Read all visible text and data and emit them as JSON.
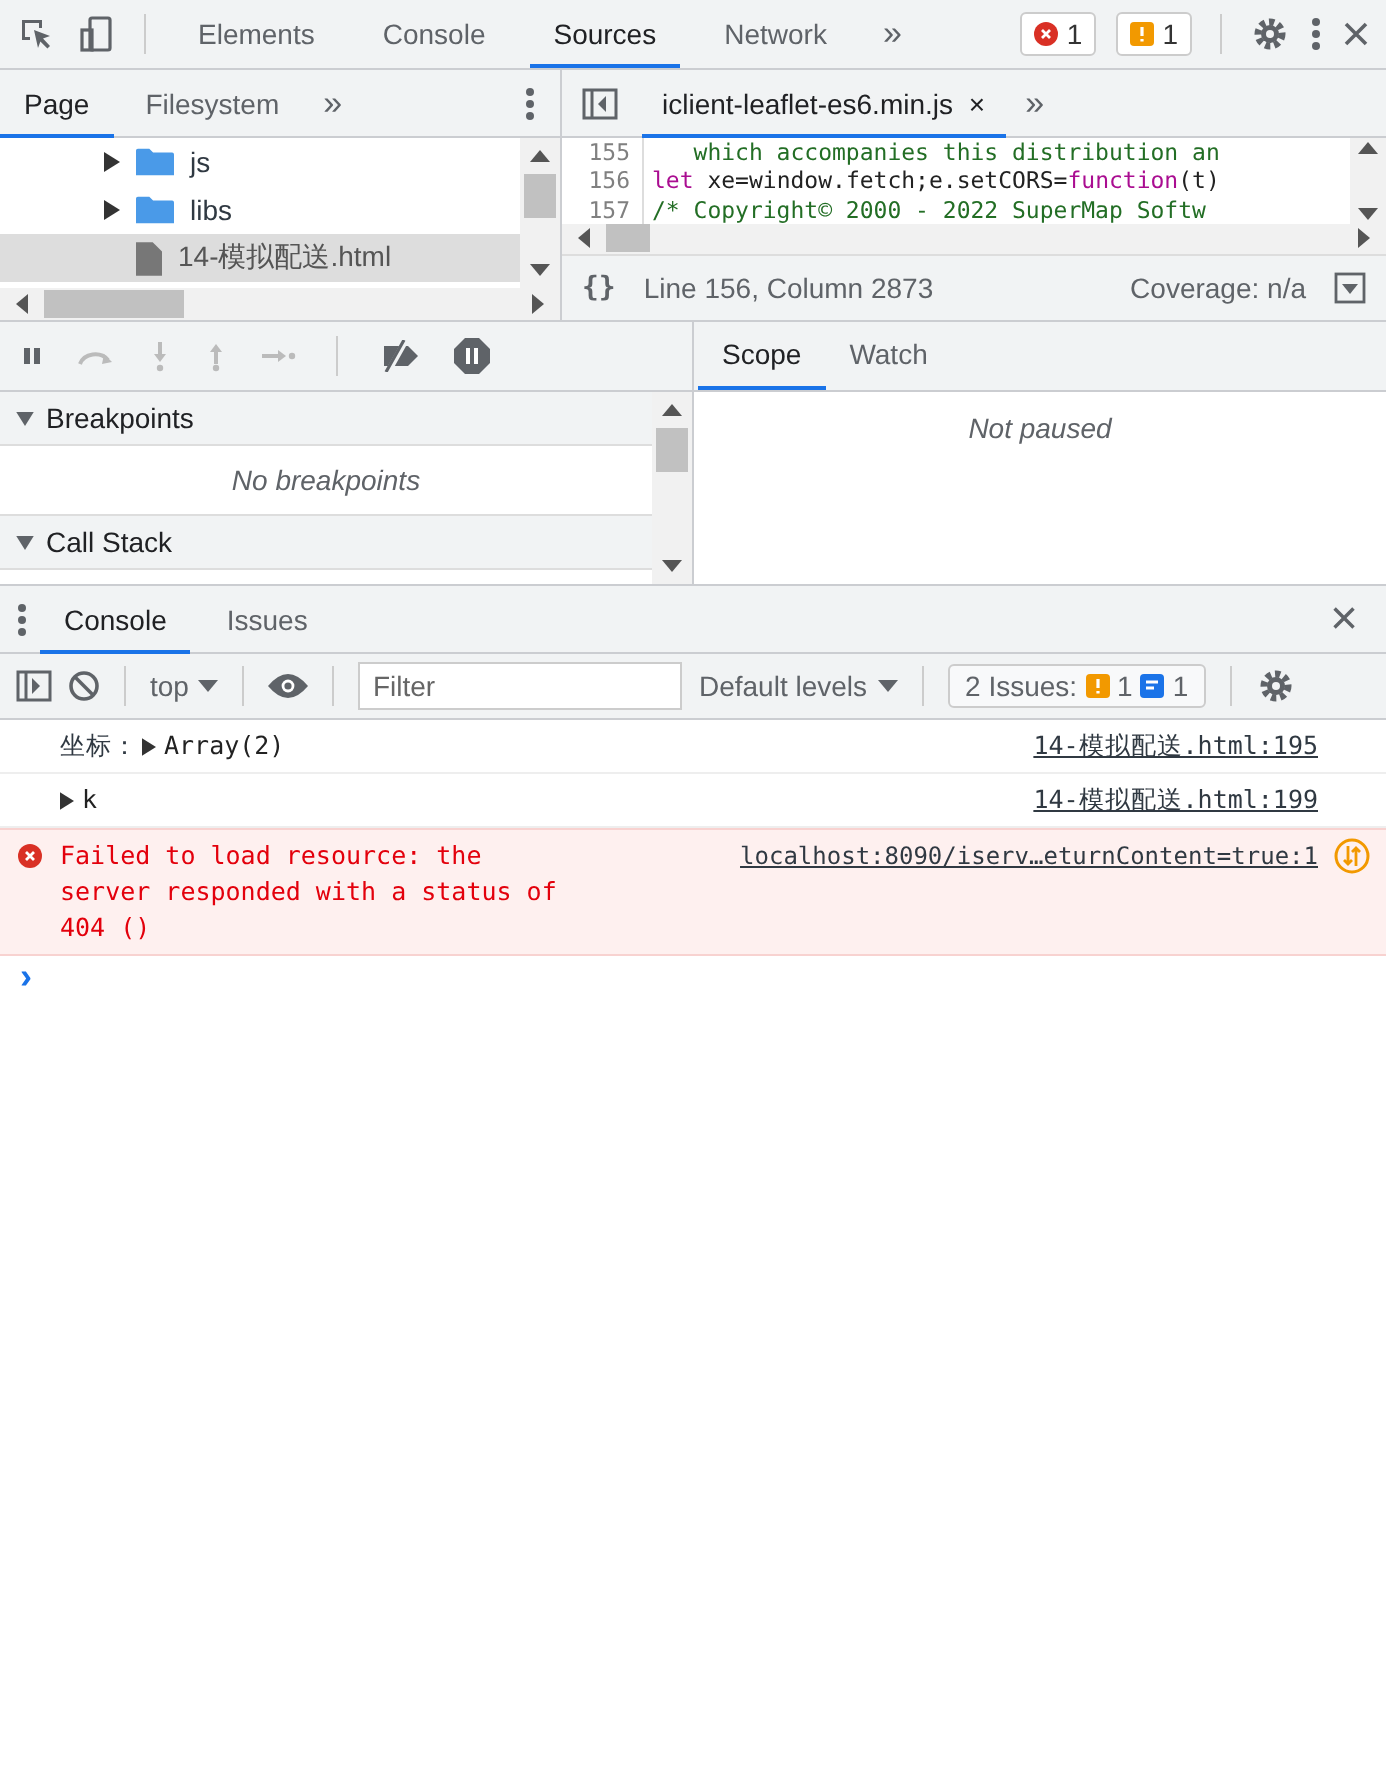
{
  "toolbar": {
    "tabs": [
      {
        "label": "Elements",
        "selected": false
      },
      {
        "label": "Console",
        "selected": false
      },
      {
        "label": "Sources",
        "selected": true
      },
      {
        "label": "Network",
        "selected": false
      }
    ],
    "more": "»",
    "error_count": "1",
    "warning_count": "1"
  },
  "navigator": {
    "tabs": [
      {
        "label": "Page",
        "selected": true
      },
      {
        "label": "Filesystem",
        "selected": false
      }
    ],
    "more": "»",
    "items": [
      {
        "name": "js",
        "kind": "folder",
        "selected": false
      },
      {
        "name": "libs",
        "kind": "folder",
        "selected": false
      },
      {
        "name": "14-模拟配送.html",
        "kind": "file",
        "selected": true
      }
    ]
  },
  "editor": {
    "tab": "iclient-leaflet-es6.min.js",
    "close": "×",
    "more": "»",
    "lines": [
      {
        "number": "155",
        "tokens": [
          {
            "text": "   which accompanies this distribution an",
            "kind": "comment"
          }
        ]
      },
      {
        "number": "156",
        "tokens": [
          {
            "text": "let",
            "kind": "keyword"
          },
          {
            "text": " xe=window.fetch;e.setCORS=",
            "kind": "plain"
          },
          {
            "text": "function",
            "kind": "keyword"
          },
          {
            "text": "(t)",
            "kind": "plain"
          }
        ]
      },
      {
        "number": "157",
        "tokens": [
          {
            "text": "/* Copyright© 2000 - 2022 SuperMap Softw",
            "kind": "comment"
          }
        ]
      }
    ],
    "format": "{}",
    "position": "Line 156, Column 2873",
    "coverage": "Coverage: n/a"
  },
  "debugger": {
    "sections": [
      {
        "title": "Breakpoints",
        "expanded": true,
        "empty_text": "No breakpoints"
      },
      {
        "title": "Call Stack",
        "expanded": true
      }
    ],
    "tabs": [
      {
        "label": "Scope",
        "selected": true
      },
      {
        "label": "Watch",
        "selected": false
      }
    ],
    "status": "Not paused"
  },
  "drawer": {
    "tabs": [
      {
        "label": "Console",
        "selected": true
      },
      {
        "label": "Issues",
        "selected": false
      }
    ],
    "close": "×",
    "context": "top",
    "filter": {
      "placeholder": "Filter"
    },
    "levels": "Default levels",
    "issues": {
      "label": "2 Issues:",
      "warnings": "1",
      "infos": "1"
    },
    "messages": [
      {
        "kind": "log",
        "text": "坐标：",
        "object": "Array(2)",
        "source": "14-模拟配送.html:195"
      },
      {
        "kind": "log",
        "object": "k",
        "source": "14-模拟配送.html:199"
      },
      {
        "kind": "error",
        "text": "Failed to load resource: the server responded with a status of 404 ()",
        "source": "localhost:8090/iserv…eturnContent=true:1"
      }
    ],
    "prompt": "›"
  }
}
